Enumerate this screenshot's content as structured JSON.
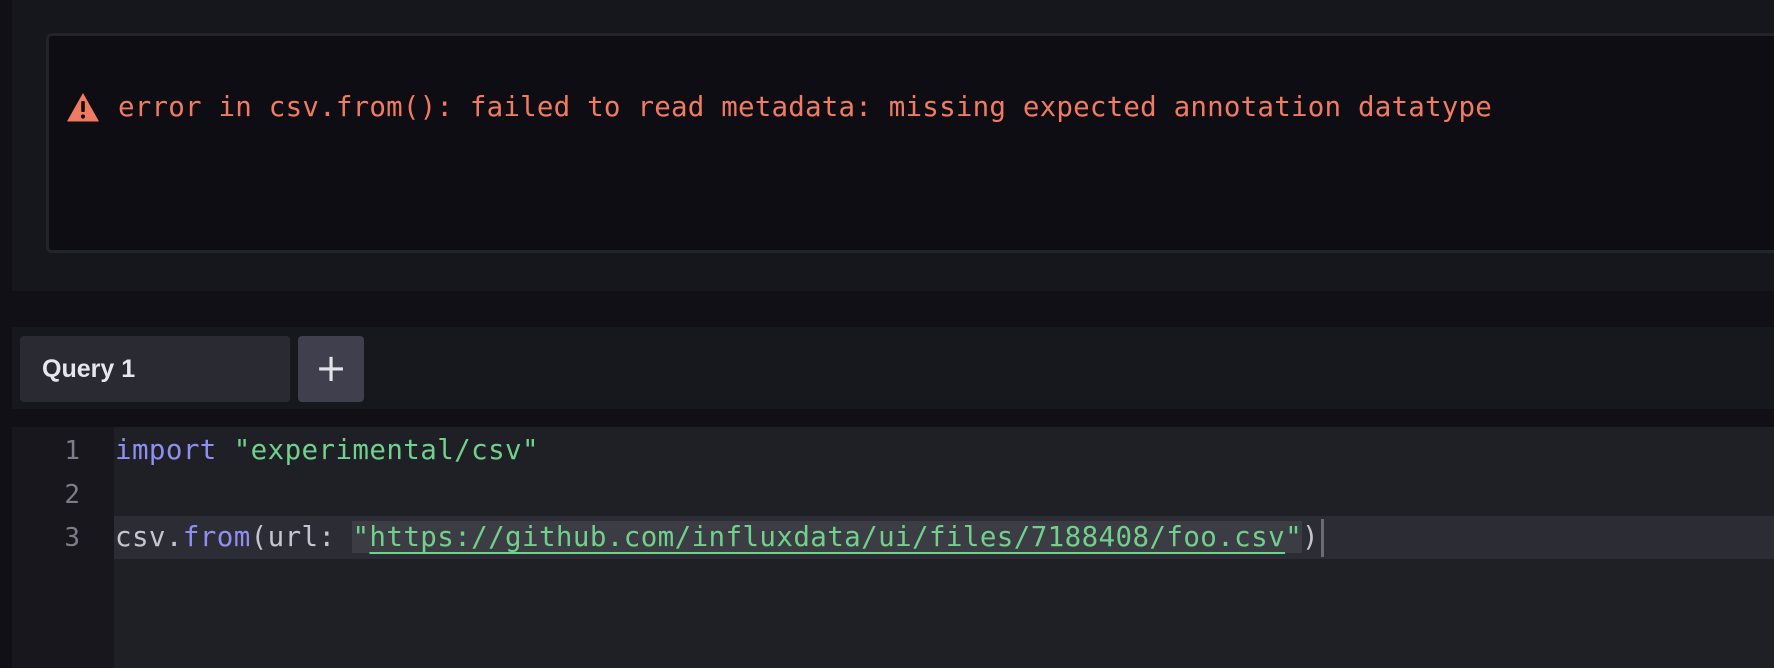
{
  "error": {
    "icon": "warning-triangle-icon",
    "message": "error in csv.from(): failed to read metadata: missing expected annotation datatype",
    "color": "#f07b62"
  },
  "query_tabs": {
    "tabs": [
      {
        "label": "Query 1"
      }
    ],
    "add_label": "+"
  },
  "editor": {
    "line_numbers": [
      "1",
      "2",
      "3"
    ],
    "lines": [
      {
        "keyword": "import",
        "space": " ",
        "string": "\"experimental/csv\""
      },
      {
        "text": ""
      },
      {
        "object": "csv",
        "dot": ".",
        "function": "from",
        "open": "(",
        "param": "url: ",
        "quote_open": "\"",
        "url": "https://github.com/influxdata/ui/files/7188408/foo.csv",
        "quote_close": "\"",
        "close": ")"
      }
    ],
    "colors": {
      "keyword": "#8f8ef2",
      "string": "#70d08c",
      "text": "#c5c5cf"
    }
  }
}
